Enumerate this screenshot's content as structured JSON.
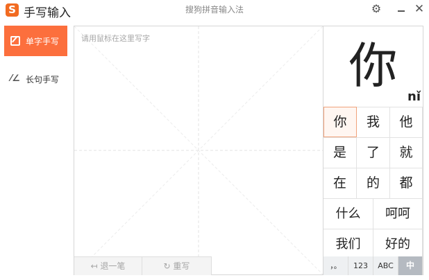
{
  "app": {
    "logo_letter": "S",
    "title": "手写输入",
    "subtitle": "搜狗拼音输入法",
    "window_controls": [
      "gear-icon",
      "minimize-icon",
      "close-icon"
    ],
    "accent_color": "#fc6f3d"
  },
  "sidebar": {
    "items": [
      {
        "label": "单字手写",
        "icon": "edit-icon",
        "active": true
      },
      {
        "label": "长句手写",
        "icon": "sentence-handwrite-icon",
        "active": false
      }
    ]
  },
  "canvas": {
    "placeholder": "请用鼠标在这里写字",
    "undo_label": "退一笔",
    "rewrite_label": "重写"
  },
  "candidates": {
    "preview_char": "你",
    "preview_pinyin": "nǐ",
    "single": [
      "你",
      "我",
      "他",
      "是",
      "了",
      "就",
      "在",
      "的",
      "都"
    ],
    "selected_index": 0,
    "words": [
      "什么",
      "呵呵",
      "我们",
      "好的"
    ]
  },
  "modes": [
    {
      "label": "，。",
      "active": false
    },
    {
      "label": "123",
      "active": false
    },
    {
      "label": "ABC",
      "active": false
    },
    {
      "label": "中",
      "active": true
    }
  ]
}
